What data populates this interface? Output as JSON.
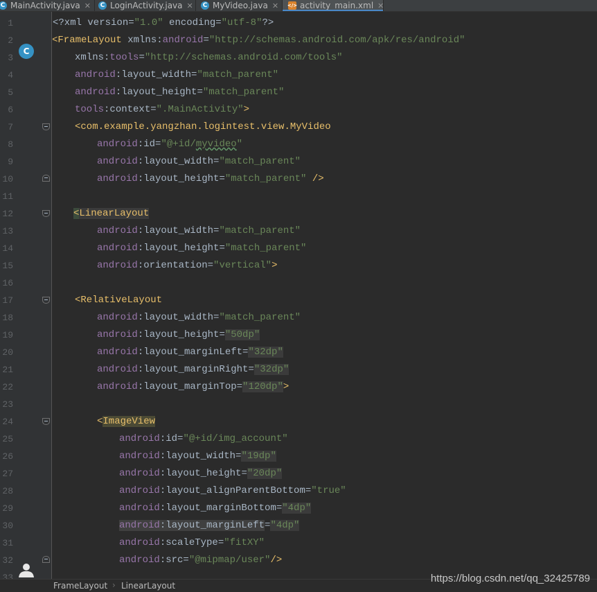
{
  "tabs": [
    {
      "label": "MainActivity.java",
      "icon": "java-class-icon"
    },
    {
      "label": "LoginActivity.java",
      "icon": "java-class-icon"
    },
    {
      "label": "MyVideo.java",
      "icon": "java-class-icon"
    },
    {
      "label": "activity_main.xml",
      "icon": "xml-file-icon"
    }
  ],
  "line_numbers": [
    "1",
    "2",
    "3",
    "4",
    "5",
    "6",
    "7",
    "8",
    "9",
    "10",
    "11",
    "12",
    "13",
    "14",
    "15",
    "16",
    "17",
    "18",
    "19",
    "20",
    "21",
    "22",
    "23",
    "24",
    "25",
    "26",
    "27",
    "28",
    "29",
    "30",
    "31",
    "32",
    "33"
  ],
  "gutter": {
    "class_marker": "C"
  },
  "code": {
    "l1": {
      "p1": "<?xml version=",
      "p2": "\"1.0\"",
      "p3": " encoding=",
      "p4": "\"utf-8\"",
      "p5": "?>"
    },
    "l2": {
      "tag": "<FrameLayout",
      "ns": " xmlns:",
      "attr": "android",
      "eq": "=",
      "val": "\"http://schemas.android.com/apk/res/android\""
    },
    "l3": {
      "ns": "xmlns:",
      "attr": "tools",
      "eq": "=",
      "val": "\"http://schemas.android.com/tools\""
    },
    "l4": {
      "prefix": "android",
      "name": ":layout_width",
      "eq": "=",
      "val": "\"match_parent\""
    },
    "l5": {
      "prefix": "android",
      "name": ":layout_height",
      "eq": "=",
      "val": "\"match_parent\""
    },
    "l6": {
      "prefix": "tools",
      "name": ":context",
      "eq": "=",
      "val": "\".MainActivity\"",
      "end": ">"
    },
    "l7": {
      "tag": "<com.example.yangzhan.logintest.view.MyVideo"
    },
    "l8": {
      "prefix": "android",
      "name": ":id",
      "eq": "=",
      "val_q1": "\"@+id/",
      "val_word": "myvideo",
      "val_q2": "\""
    },
    "l9": {
      "prefix": "android",
      "name": ":layout_width",
      "eq": "=",
      "val": "\"match_parent\""
    },
    "l10": {
      "prefix": "android",
      "name": ":layout_height",
      "eq": "=",
      "val": "\"match_parent\"",
      "end": " />"
    },
    "l12": {
      "lt": "<",
      "tag": "LinearLayout"
    },
    "l13": {
      "prefix": "android",
      "name": ":layout_width",
      "eq": "=",
      "val": "\"match_parent\""
    },
    "l14": {
      "prefix": "android",
      "name": ":layout_height",
      "eq": "=",
      "val": "\"match_parent\""
    },
    "l15": {
      "prefix": "android",
      "name": ":orientation",
      "eq": "=",
      "val": "\"vertical\"",
      "end": ">"
    },
    "l17": {
      "tag": "<RelativeLayout"
    },
    "l18": {
      "prefix": "android",
      "name": ":layout_width",
      "eq": "=",
      "val": "\"match_parent\""
    },
    "l19": {
      "prefix": "android",
      "name": ":layout_height",
      "eq": "=",
      "val": "\"50dp\""
    },
    "l20": {
      "prefix": "android",
      "name": ":layout_marginLeft",
      "eq": "=",
      "val": "\"32dp\""
    },
    "l21": {
      "prefix": "android",
      "name": ":layout_marginRight",
      "eq": "=",
      "val": "\"32dp\""
    },
    "l22": {
      "prefix": "android",
      "name": ":layout_marginTop",
      "eq": "=",
      "val": "\"120dp\"",
      "end": ">"
    },
    "l24": {
      "lt": "<",
      "tag": "ImageView"
    },
    "l25": {
      "prefix": "android",
      "name": ":id",
      "eq": "=",
      "val": "\"@+id/img_account\""
    },
    "l26": {
      "prefix": "android",
      "name": ":layout_width",
      "eq": "=",
      "val": "\"19dp\""
    },
    "l27": {
      "prefix": "android",
      "name": ":layout_height",
      "eq": "=",
      "val": "\"20dp\""
    },
    "l28": {
      "prefix": "android",
      "name": ":layout_alignParentBottom",
      "eq": "=",
      "val": "\"true\""
    },
    "l29": {
      "prefix": "android",
      "name": ":layout_marginBottom",
      "eq": "=",
      "val": "\"4dp\""
    },
    "l30": {
      "prefix": "android",
      "name": ":layout_marginLeft",
      "eq": "=",
      "val": "\"4dp\""
    },
    "l31": {
      "prefix": "android",
      "name": ":scaleType",
      "eq": "=",
      "val": "\"fitXY\""
    },
    "l32": {
      "prefix": "android",
      "name": ":src",
      "eq": "=",
      "val": "\"@mipmap/user\"",
      "end": "/>"
    }
  },
  "breadcrumb": [
    "FrameLayout",
    "LinearLayout"
  ],
  "breadcrumb_sep": "›",
  "watermark": "https://blog.csdn.net/qq_32425789",
  "colors": {
    "background": "#2b2b2b",
    "gutter": "#313335",
    "tag": "#e8bf6a",
    "attribute": "#9876aa",
    "string": "#6a8759",
    "text": "#a9b7c6",
    "accent": "#4a88c7"
  }
}
